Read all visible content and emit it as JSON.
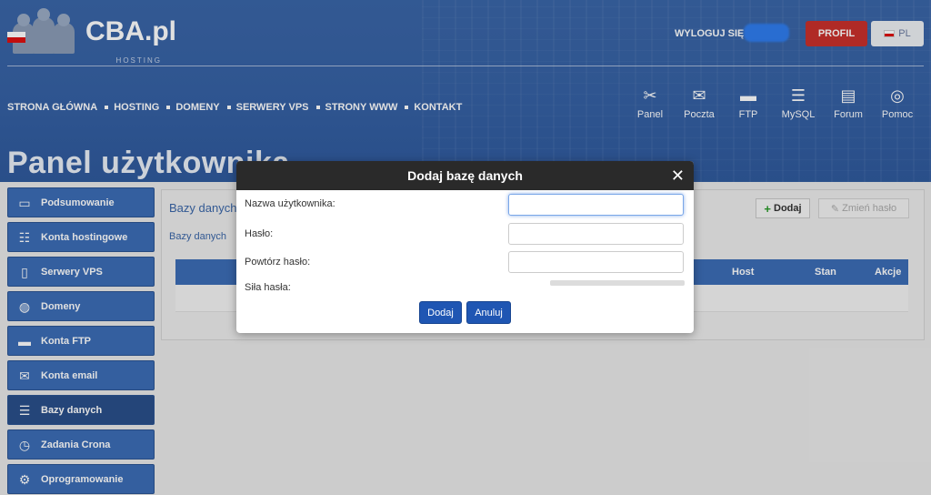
{
  "header": {
    "logo_text": "CBA",
    "logo_tld": ".pl",
    "logo_sub": "HOSTING",
    "logo_people_letters": [
      "C",
      "B",
      "A"
    ],
    "logout_label": "WYLOGUJ SIĘ",
    "profile_button": "PROFIL",
    "lang_button": "PL",
    "accent_red": "#c9302c",
    "header_blue": "#3a66a8"
  },
  "nav": {
    "items": [
      "STRONA GŁÓWNA",
      "HOSTING",
      "DOMENY",
      "SERWERY VPS",
      "STRONY WWW",
      "KONTAKT"
    ]
  },
  "tools": [
    {
      "label": "Panel",
      "icon": "tools-icon"
    },
    {
      "label": "Poczta",
      "icon": "mail-icon"
    },
    {
      "label": "FTP",
      "icon": "folder-icon"
    },
    {
      "label": "MySQL",
      "icon": "database-icon"
    },
    {
      "label": "Forum",
      "icon": "chat-icon"
    },
    {
      "label": "Pomoc",
      "icon": "lifebuoy-icon"
    }
  ],
  "page_title": "Panel użytkownika",
  "sidebar": {
    "items": [
      {
        "label": "Podsumowanie",
        "icon": "monitor-icon"
      },
      {
        "label": "Konta hostingowe",
        "icon": "server-icon"
      },
      {
        "label": "Serwery VPS",
        "icon": "vps-icon"
      },
      {
        "label": "Domeny",
        "icon": "www-icon"
      },
      {
        "label": "Konta FTP",
        "icon": "ftp-folder-icon"
      },
      {
        "label": "Konta email",
        "icon": "email-icon"
      },
      {
        "label": "Bazy danych",
        "icon": "database-icon",
        "active": true
      },
      {
        "label": "Zadania Crona",
        "icon": "clock-icon"
      },
      {
        "label": "Oprogramowanie",
        "icon": "gear-icon"
      }
    ]
  },
  "main": {
    "tab_title": "Bazy danych",
    "breadcrumb": "Bazy danych",
    "add_button": "Dodaj",
    "change_password_button": "Zmień hasło",
    "table_headers": [
      "Host",
      "Stan",
      "Akcje"
    ]
  },
  "modal": {
    "title": "Dodaj bazę danych",
    "close": "✕",
    "username_label": "Nazwa użytkownika:",
    "username_value": "",
    "password_label": "Hasło:",
    "password_value": "",
    "repeat_label": "Powtórz hasło:",
    "repeat_value": "",
    "strength_label": "Siła hasła:",
    "submit_button": "Dodaj",
    "cancel_button": "Anuluj"
  }
}
